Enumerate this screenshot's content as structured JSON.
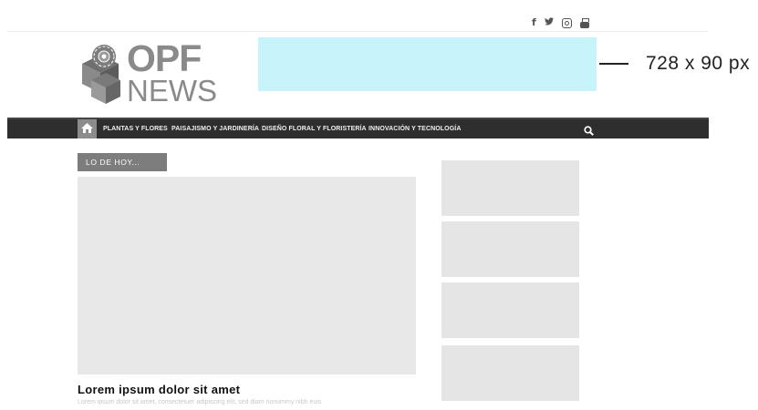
{
  "social": {
    "icons": [
      "facebook-icon",
      "twitter-icon",
      "instagram-icon",
      "youtube-icon"
    ],
    "facebook_glyph": "f",
    "twitter_glyph": "🐦"
  },
  "logo": {
    "line1": "OPF",
    "line2": "NEWS"
  },
  "ad": {
    "label": "728 x 90 px",
    "color": "#c7f4fa"
  },
  "nav": {
    "items": [
      "PLANTAS Y FLORES",
      "PAISAJISMO Y JARDINERÍA",
      "DISEÑO FLORAL Y FLORISTERÍA",
      "INNOVACIÓN Y TECNOLOGÍA"
    ]
  },
  "section": {
    "label": "LO DE HOY..."
  },
  "featured": {
    "title": "Lorem ipsum dolor sit amet",
    "excerpt": "Lorem ipsum dolor sit amet, consectetuer adipiscing elit, sed diam nonummy nibh euis"
  },
  "colors": {
    "nav_bg": "#2e2e2e",
    "home_bg": "#8c8c8c",
    "placeholder": "#e8e8e8"
  }
}
